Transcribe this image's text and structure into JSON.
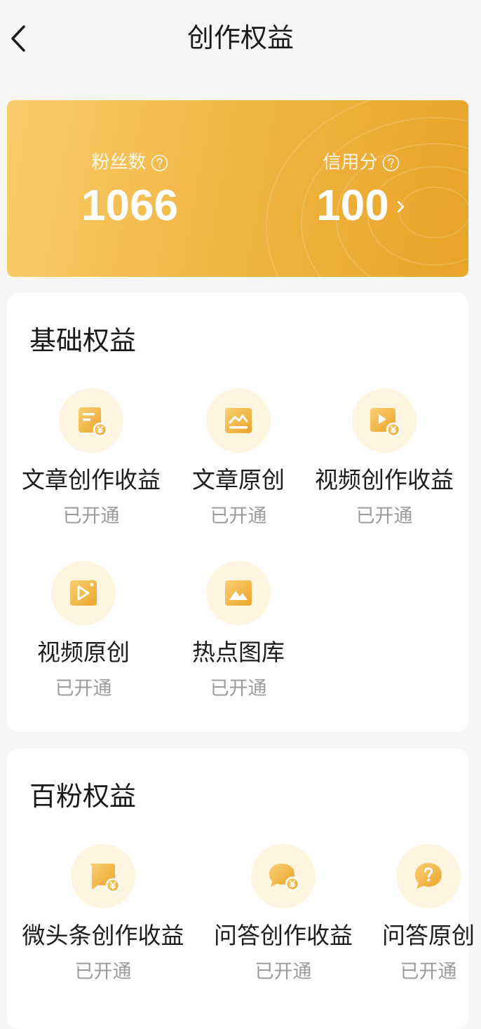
{
  "header": {
    "title": "创作权益"
  },
  "stats": {
    "fans_label": "粉丝数",
    "fans_value": "1066",
    "credit_label": "信用分",
    "credit_value": "100"
  },
  "basic": {
    "title": "基础权益",
    "items": [
      {
        "label": "文章创作收益",
        "status": "已开通",
        "icon": "article-income-icon"
      },
      {
        "label": "文章原创",
        "status": "已开通",
        "icon": "article-original-icon"
      },
      {
        "label": "视频创作收益",
        "status": "已开通",
        "icon": "video-income-icon"
      },
      {
        "label": "视频原创",
        "status": "已开通",
        "icon": "video-original-icon"
      },
      {
        "label": "热点图库",
        "status": "已开通",
        "icon": "image-gallery-icon"
      }
    ]
  },
  "hundred": {
    "title": "百粉权益",
    "items": [
      {
        "label": "微头条创作收益",
        "status": "已开通",
        "icon": "micro-post-income-icon"
      },
      {
        "label": "问答创作收益",
        "status": "已开通",
        "icon": "qa-income-icon"
      },
      {
        "label": "问答原创",
        "status": "已开通",
        "icon": "qa-original-icon"
      }
    ]
  },
  "colors": {
    "accent": "#f0b440",
    "icon_bg": "#fff4df",
    "muted_text": "#9b9b9b"
  }
}
